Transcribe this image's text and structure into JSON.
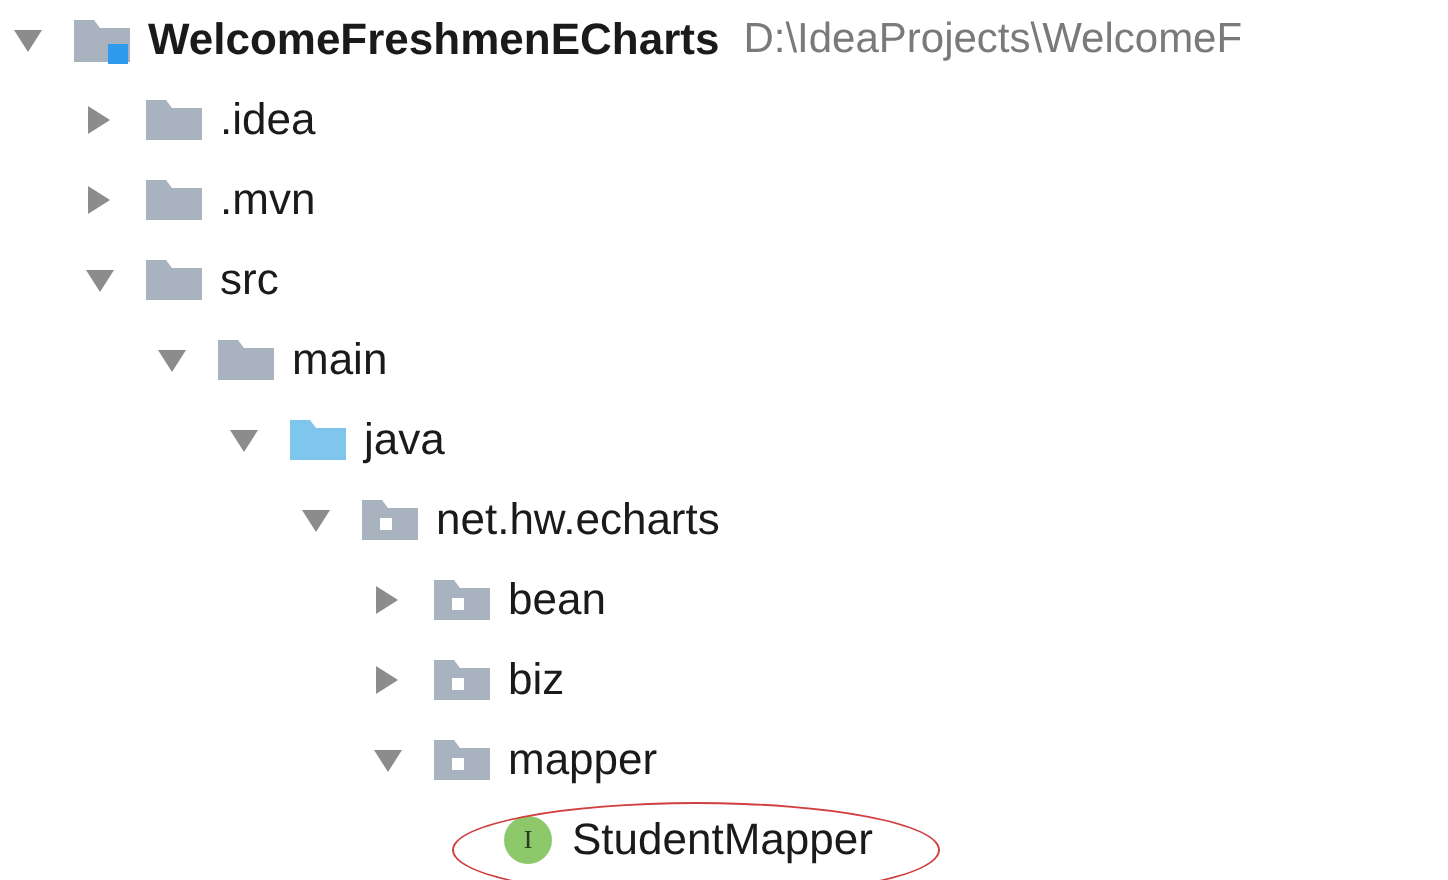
{
  "project_tree": {
    "root": {
      "label": "WelcomeFreshmenECharts",
      "path": "D:\\IdeaProjects\\WelcomeF",
      "kind": "module",
      "expanded": true,
      "children": [
        {
          "label": ".idea",
          "kind": "folder",
          "expanded": false
        },
        {
          "label": ".mvn",
          "kind": "folder",
          "expanded": false
        },
        {
          "label": "src",
          "kind": "folder",
          "expanded": true,
          "children": [
            {
              "label": "main",
              "kind": "folder",
              "expanded": true,
              "children": [
                {
                  "label": "java",
                  "kind": "source",
                  "expanded": true,
                  "children": [
                    {
                      "label": "net.hw.echarts",
                      "kind": "package",
                      "expanded": true,
                      "children": [
                        {
                          "label": "bean",
                          "kind": "package",
                          "expanded": false
                        },
                        {
                          "label": "biz",
                          "kind": "package",
                          "expanded": false
                        },
                        {
                          "label": "mapper",
                          "kind": "package",
                          "expanded": true,
                          "children": [
                            {
                              "label": "StudentMapper",
                              "kind": "interface",
                              "badge": "I",
                              "highlighted": true
                            }
                          ]
                        }
                      ]
                    }
                  ]
                }
              ]
            }
          ]
        }
      ]
    }
  }
}
